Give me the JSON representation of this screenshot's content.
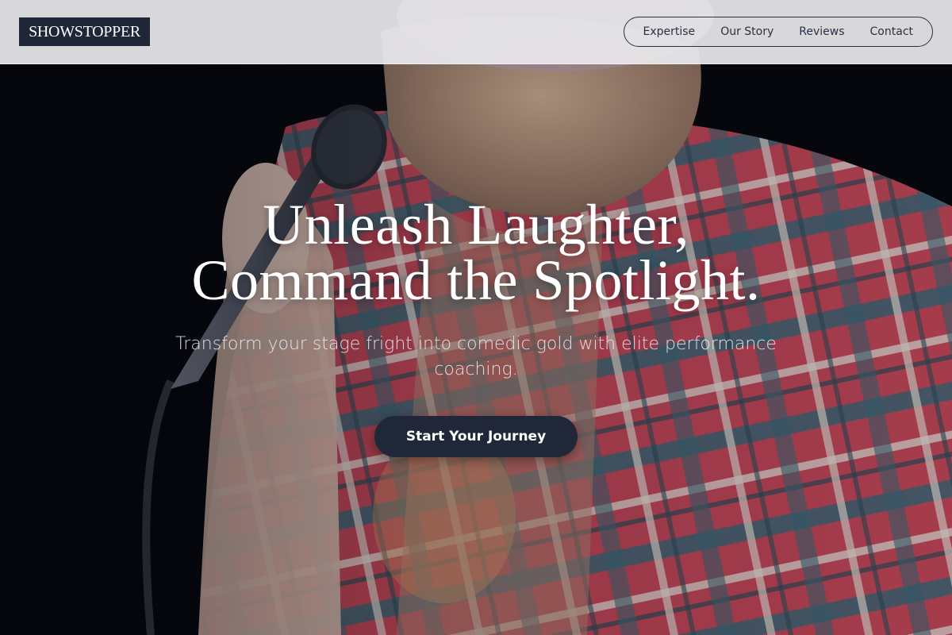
{
  "header": {
    "logo_text": "SHOWSTOPPER",
    "nav": [
      {
        "label": "Expertise"
      },
      {
        "label": "Our Story"
      },
      {
        "label": "Reviews"
      },
      {
        "label": "Contact"
      }
    ]
  },
  "hero": {
    "headline_line1": "Unleash Laughter,",
    "headline_line2": "Command the Spotlight.",
    "subheadline": "Transform your stage fright into comedic gold with elite performance coaching.",
    "cta_label": "Start Your Journey",
    "background_image": "comedian holding microphone wearing plaid flannel shirt"
  },
  "colors": {
    "header_bg": "#e8e8ec",
    "logo_bg": "#1e2638",
    "cta_bg": "#1f2738",
    "text_light": "#ffffff"
  }
}
